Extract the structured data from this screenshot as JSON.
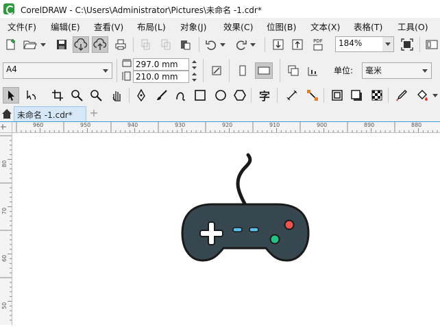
{
  "window": {
    "title": "CorelDRAW - C:\\Users\\Administrator\\Pictures\\未命名 -1.cdr*"
  },
  "menu": [
    "文件(F)",
    "编辑(E)",
    "查看(V)",
    "布局(L)",
    "对象(J)",
    "效果(C)",
    "位图(B)",
    "文本(X)",
    "表格(T)",
    "工具(O)"
  ],
  "toolbar": {
    "zoom": "184%",
    "pdf_label": "PDF"
  },
  "property_bar": {
    "page_size": "A4",
    "width": "297.0 mm",
    "height": "210.0 mm",
    "unit_label": "单位:",
    "unit_value": "毫米"
  },
  "toolbox": {
    "text_tool_glyph": "字"
  },
  "document_tab": {
    "label": "未命名 -1.cdr*",
    "add_label": "+"
  },
  "ruler_h": [
    "960",
    "950",
    "940",
    "930",
    "920",
    "910",
    "900",
    "890",
    "880"
  ],
  "ruler_v": [
    "80",
    "70",
    "60",
    "50"
  ],
  "colors": {
    "gamepad_body": "#37474f",
    "outline": "#1a1a1a",
    "button_red": "#ef5350",
    "button_green": "#26c281",
    "dash": "#5bc0eb"
  }
}
